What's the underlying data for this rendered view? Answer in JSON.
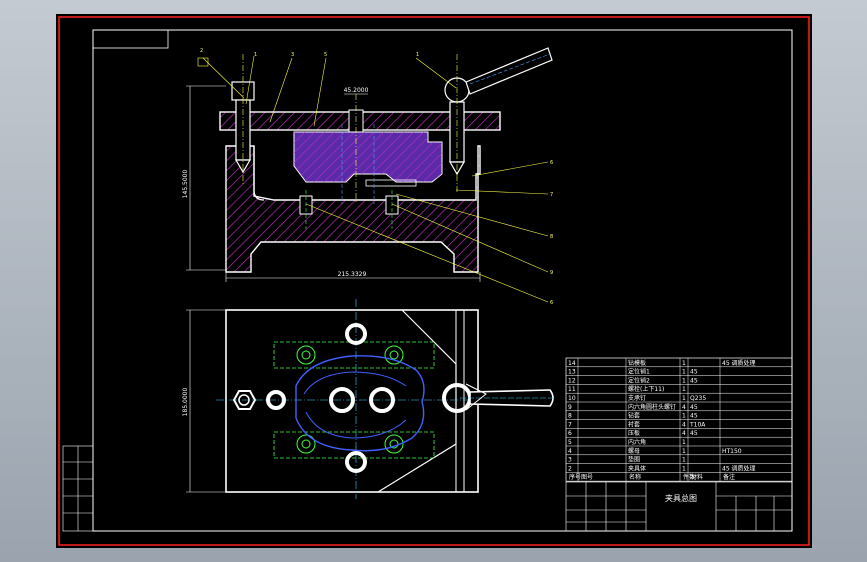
{
  "drawing": {
    "dims": {
      "top_height": "145.5000",
      "top_width": "215.3329",
      "top_center": "45.2000",
      "plan_height": "185.0000"
    },
    "balloons": [
      "2",
      "1",
      "3",
      "5",
      "1",
      "6",
      "7",
      "8",
      "9",
      "6"
    ],
    "title_block": {
      "drawing_name": "夹具总图"
    },
    "parts_list": {
      "header": [
        "序号",
        "图号",
        "名称",
        "件数",
        "材料",
        "备注"
      ],
      "rows": [
        {
          "no": "14",
          "name": "钻模板",
          "qty": "1",
          "mat": "",
          "note": "45 调质处理"
        },
        {
          "no": "13",
          "name": "定位销1",
          "qty": "1",
          "mat": "45",
          "note": ""
        },
        {
          "no": "12",
          "name": "定位销2",
          "qty": "1",
          "mat": "45",
          "note": ""
        },
        {
          "no": "11",
          "name": "螺栓(上下11)",
          "qty": "1",
          "mat": "",
          "note": ""
        },
        {
          "no": "10",
          "name": "支承钉",
          "qty": "1",
          "mat": "Q235",
          "note": ""
        },
        {
          "no": "9",
          "name": "内六角圆柱头螺钉",
          "qty": "4",
          "mat": "45",
          "note": ""
        },
        {
          "no": "8",
          "name": "钻套",
          "qty": "1",
          "mat": "45",
          "note": ""
        },
        {
          "no": "7",
          "name": "衬套",
          "qty": "4",
          "mat": "T10A",
          "note": ""
        },
        {
          "no": "6",
          "name": "压板",
          "qty": "4",
          "mat": "45",
          "note": ""
        },
        {
          "no": "5",
          "name": "内六角",
          "qty": "1",
          "mat": "",
          "note": ""
        },
        {
          "no": "4",
          "name": "螺母",
          "qty": "1",
          "mat": "",
          "note": "HT150"
        },
        {
          "no": "3",
          "name": "垫圈",
          "qty": "1",
          "mat": "",
          "note": ""
        },
        {
          "no": "2",
          "name": "夹具体",
          "qty": "1",
          "mat": "",
          "note": "45 调质处理"
        }
      ]
    }
  }
}
